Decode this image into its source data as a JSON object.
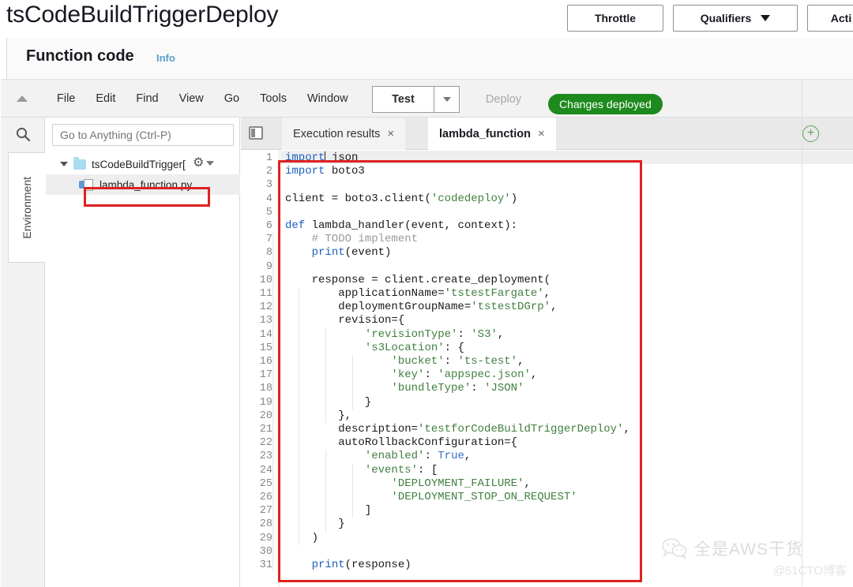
{
  "header": {
    "function_name": "tsCodeBuildTriggerDeploy",
    "buttons": [
      {
        "label": "Throttle",
        "name": "throttle-button"
      },
      {
        "label": "Qualifiers",
        "name": "qualifiers-button"
      },
      {
        "label": "Acti",
        "name": "actions-button"
      }
    ]
  },
  "function_code": {
    "title": "Function code",
    "info_link": "Info"
  },
  "menubar": {
    "items": [
      "File",
      "Edit",
      "Find",
      "View",
      "Go",
      "Tools",
      "Window"
    ],
    "test_label": "Test",
    "deploy_label": "Deploy",
    "status_pill": "Changes deployed",
    "status_pill_color": "#1d8a1d"
  },
  "left_rail": {
    "search_icon": "search-icon",
    "environment_tab": "Environment"
  },
  "explorer": {
    "goto_placeholder": "Go to Anything (Ctrl-P)",
    "folder": "tsCodeBuildTrigger[",
    "file": "lambda_function.py",
    "gear_icon": "gear-icon"
  },
  "tabs": {
    "execution_results": "Execution results",
    "lambda_function": "lambda_function",
    "close_glyph": "×",
    "add_glyph": "+"
  },
  "annotation": {
    "color": "#e02020"
  },
  "watermark": {
    "title": "全是AWS干货",
    "subtitle": "@51CTO博客"
  },
  "code": {
    "language": "python",
    "line_count": 31,
    "lines": [
      "import json",
      "import boto3",
      "",
      "client = boto3.client('codedeploy')",
      "",
      "def lambda_handler(event, context):",
      "    # TODO implement",
      "    print(event)",
      "",
      "    response = client.create_deployment(",
      "        applicationName='tstestFargate',",
      "        deploymentGroupName='tstestDGrp',",
      "        revision={",
      "            'revisionType': 'S3',",
      "            's3Location': {",
      "                'bucket': 'ts-test',",
      "                'key': 'appspec.json',",
      "                'bundleType': 'JSON'",
      "            }",
      "        },",
      "        description='testforCodeBuildTriggerDeploy',",
      "        autoRollbackConfiguration={",
      "            'enabled': True,",
      "            'events': [",
      "                'DEPLOYMENT_FAILURE',",
      "                'DEPLOYMENT_STOP_ON_REQUEST'",
      "            ]",
      "        }",
      "    )",
      "",
      "    print(response)"
    ],
    "tokens": [
      [
        [
          "k",
          "import"
        ],
        [
          "f",
          " json"
        ]
      ],
      [
        [
          "k",
          "import"
        ],
        [
          "f",
          " boto3"
        ]
      ],
      [],
      [
        [
          "f",
          "client = boto3."
        ],
        [
          "f",
          "client"
        ],
        [
          "f",
          "("
        ],
        [
          "s",
          "'codedeploy'"
        ],
        [
          "f",
          ")"
        ]
      ],
      [],
      [
        [
          "k",
          "def"
        ],
        [
          "f",
          " lambda_handler(event, context):"
        ]
      ],
      [
        [
          "c",
          "    # TODO implement"
        ]
      ],
      [
        [
          "f",
          "    "
        ],
        [
          "k",
          "print"
        ],
        [
          "f",
          "(event)"
        ]
      ],
      [],
      [
        [
          "f",
          "    response = client."
        ],
        [
          "f",
          "create_deployment("
        ]
      ],
      [
        [
          "f",
          "        applicationName="
        ],
        [
          "s",
          "'tstestFargate'"
        ],
        [
          "f",
          ","
        ]
      ],
      [
        [
          "f",
          "        deploymentGroupName="
        ],
        [
          "s",
          "'tstestDGrp'"
        ],
        [
          "f",
          ","
        ]
      ],
      [
        [
          "f",
          "        revision={"
        ]
      ],
      [
        [
          "f",
          "            "
        ],
        [
          "s",
          "'revisionType'"
        ],
        [
          "f",
          ": "
        ],
        [
          "s",
          "'S3'"
        ],
        [
          "f",
          ","
        ]
      ],
      [
        [
          "f",
          "            "
        ],
        [
          "s",
          "'s3Location'"
        ],
        [
          "f",
          ": {"
        ]
      ],
      [
        [
          "f",
          "                "
        ],
        [
          "s",
          "'bucket'"
        ],
        [
          "f",
          ": "
        ],
        [
          "s",
          "'ts-test'"
        ],
        [
          "f",
          ","
        ]
      ],
      [
        [
          "f",
          "                "
        ],
        [
          "s",
          "'key'"
        ],
        [
          "f",
          ": "
        ],
        [
          "s",
          "'appspec.json'"
        ],
        [
          "f",
          ","
        ]
      ],
      [
        [
          "f",
          "                "
        ],
        [
          "s",
          "'bundleType'"
        ],
        [
          "f",
          ": "
        ],
        [
          "s",
          "'JSON'"
        ]
      ],
      [
        [
          "f",
          "            }"
        ]
      ],
      [
        [
          "f",
          "        },"
        ]
      ],
      [
        [
          "f",
          "        description="
        ],
        [
          "s",
          "'testforCodeBuildTriggerDeploy'"
        ],
        [
          "f",
          ","
        ]
      ],
      [
        [
          "f",
          "        autoRollbackConfiguration={"
        ]
      ],
      [
        [
          "f",
          "            "
        ],
        [
          "s",
          "'enabled'"
        ],
        [
          "f",
          ": "
        ],
        [
          "b",
          "True"
        ],
        [
          "f",
          ","
        ]
      ],
      [
        [
          "f",
          "            "
        ],
        [
          "s",
          "'events'"
        ],
        [
          "f",
          ": ["
        ]
      ],
      [
        [
          "f",
          "                "
        ],
        [
          "s",
          "'DEPLOYMENT_FAILURE'"
        ],
        [
          "f",
          ","
        ]
      ],
      [
        [
          "f",
          "                "
        ],
        [
          "s",
          "'DEPLOYMENT_STOP_ON_REQUEST'"
        ]
      ],
      [
        [
          "f",
          "            ]"
        ]
      ],
      [
        [
          "f",
          "        }"
        ]
      ],
      [
        [
          "f",
          "    )"
        ]
      ],
      [],
      [
        [
          "f",
          "    "
        ],
        [
          "k",
          "print"
        ],
        [
          "f",
          "(response)"
        ]
      ]
    ]
  }
}
